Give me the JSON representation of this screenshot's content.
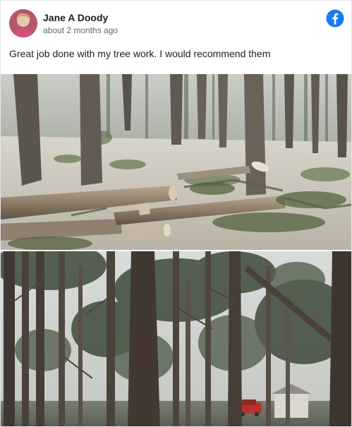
{
  "post": {
    "author_name": "Jane A Doody",
    "timestamp": "about 2 months ago",
    "body_text": "Great job done with my tree work. I would recommend them",
    "source_icon": "facebook-icon",
    "avatar_icon": "profile-photo",
    "photos": [
      {
        "icon": "photo-felled-trees",
        "subject": "felled logs in snowy woods"
      },
      {
        "icon": "photo-tall-trees",
        "subject": "tall pine trees with house in background"
      }
    ]
  },
  "colors": {
    "facebook_blue": "#1877f2",
    "name_text": "#1c1e21",
    "secondary_text": "#65676b",
    "card_border": "#e4e6eb"
  }
}
